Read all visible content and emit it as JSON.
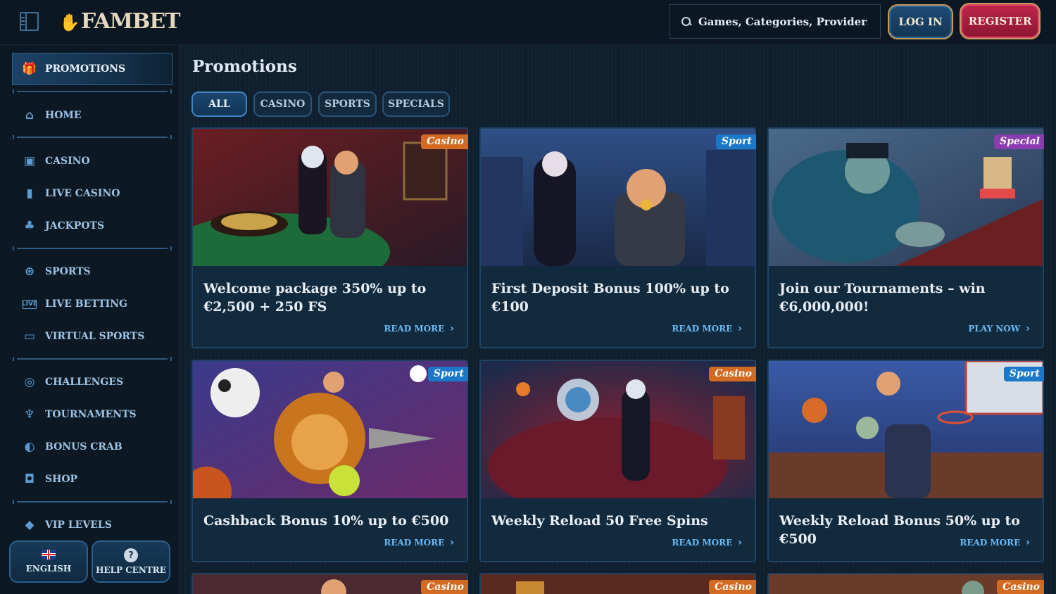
{
  "header": {
    "logo": "FAMBET",
    "search_placeholder": "Games, Categories, Providers",
    "login_label": "LOG IN",
    "register_label": "REGISTER"
  },
  "sidebar": {
    "items": [
      {
        "label": "PROMOTIONS",
        "icon": "gift-icon"
      },
      {
        "label": "HOME",
        "icon": "home-icon"
      },
      {
        "label": "CASINO",
        "icon": "slot-machine-icon"
      },
      {
        "label": "LIVE CASINO",
        "icon": "live-card-icon"
      },
      {
        "label": "JACKPOTS",
        "icon": "clover-icon"
      },
      {
        "label": "SPORTS",
        "icon": "ball-icon"
      },
      {
        "label": "LIVE BETTING",
        "icon": "live-badge-icon"
      },
      {
        "label": "VIRTUAL SPORTS",
        "icon": "monitor-icon"
      },
      {
        "label": "CHALLENGES",
        "icon": "target-icon"
      },
      {
        "label": "TOURNAMENTS",
        "icon": "trophy-icon"
      },
      {
        "label": "BONUS CRAB",
        "icon": "claw-icon"
      },
      {
        "label": "SHOP",
        "icon": "bag-icon"
      },
      {
        "label": "VIP LEVELS",
        "icon": "diamond-icon"
      }
    ],
    "language_label": "ENGLISH",
    "help_label": "HELP CENTRE"
  },
  "main": {
    "title": "Promotions",
    "filters": [
      "ALL",
      "CASINO",
      "SPORTS",
      "SPECIALS"
    ],
    "active_filter": "ALL",
    "cards": [
      {
        "badge": "Casino",
        "title": "Welcome package 350% up to €2,500 + 250 FS",
        "cta": "READ MORE"
      },
      {
        "badge": "Sport",
        "title": "First Deposit Bonus 100% up to €100",
        "cta": "READ MORE"
      },
      {
        "badge": "Special",
        "title": "Join our Tournaments – win €6,000,000!",
        "cta": "PLAY NOW"
      },
      {
        "badge": "Sport",
        "title": "Cashback Bonus 10% up to €500",
        "cta": "READ MORE"
      },
      {
        "badge": "Casino",
        "title": "Weekly Reload 50 Free Spins",
        "cta": "READ MORE"
      },
      {
        "badge": "Sport",
        "title": "Weekly Reload Bonus 50% up to €500",
        "cta": "READ MORE"
      },
      {
        "badge": "Casino"
      },
      {
        "badge": "Casino"
      },
      {
        "badge": "Casino"
      }
    ]
  },
  "colors": {
    "accent": "#3f86c6",
    "register": "#c0264a",
    "badge_casino": "#d26a21",
    "badge_sport": "#1b77c8",
    "badge_special": "#8a3cb0"
  }
}
